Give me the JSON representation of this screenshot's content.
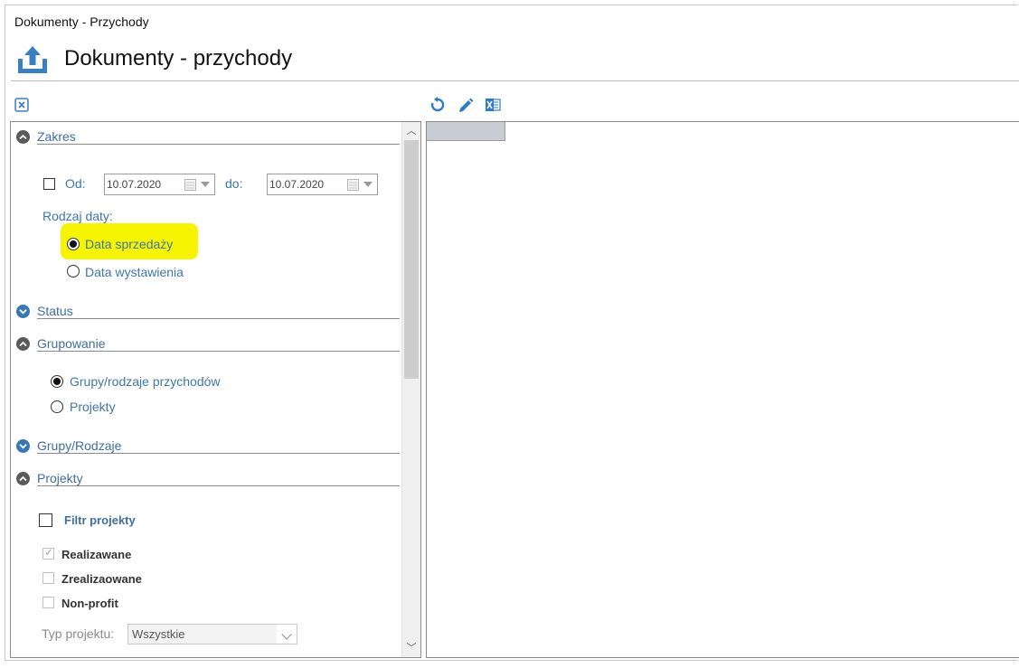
{
  "window": {
    "title": "Dokumenty - Przychody"
  },
  "header": {
    "title": "Dokumenty - przychody",
    "icon": "export-tray-icon"
  },
  "toolbar": {
    "icons": [
      "close-panel-icon",
      "refresh-icon",
      "edit-icon",
      "excel-icon"
    ]
  },
  "sections": {
    "zakres": {
      "label": "Zakres",
      "state": "expanded",
      "od_label": "Od:",
      "od_checked": false,
      "date_from": "10.07.2020",
      "do_label": "do:",
      "date_to": "10.07.2020",
      "rodzaj_daty_label": "Rodzaj daty:",
      "options": [
        {
          "label": "Data sprzedaży",
          "selected": true,
          "highlighted": true
        },
        {
          "label": "Data wystawienia",
          "selected": false
        }
      ]
    },
    "status": {
      "label": "Status",
      "state": "collapsed"
    },
    "grupowanie": {
      "label": "Grupowanie",
      "state": "expanded",
      "options": [
        {
          "label": "Grupy/rodzaje przychodów",
          "selected": true
        },
        {
          "label": "Projekty",
          "selected": false
        }
      ]
    },
    "grupy": {
      "label": "Grupy/Rodzaje",
      "state": "collapsed"
    },
    "projekty": {
      "label": "Projekty",
      "state": "expanded",
      "filter_label": "Filtr projekty",
      "filter_checked": false,
      "checks": [
        {
          "label": "Realizawane",
          "checked": true,
          "disabled": true
        },
        {
          "label": "Zrealizaowane",
          "checked": false,
          "disabled": true
        },
        {
          "label": "Non-profit",
          "checked": false,
          "disabled": true
        }
      ],
      "typ_label": "Typ projektu:",
      "typ_value": "Wszystkie"
    }
  },
  "colors": {
    "label_blue": "#3f76a8",
    "highlight": "#f6f400",
    "section_icon": "#3f6f9d"
  }
}
